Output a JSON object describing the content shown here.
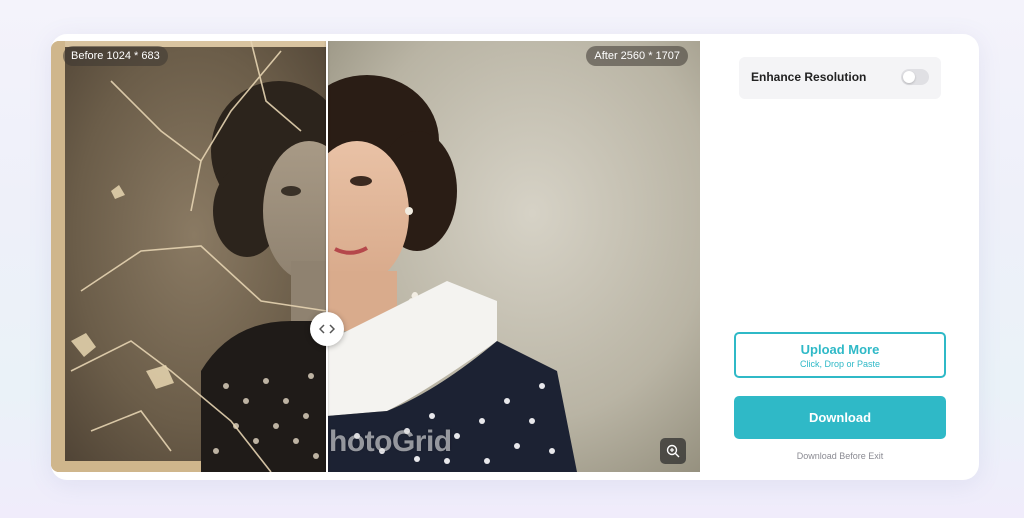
{
  "viewer": {
    "before_label": "Before 1024 * 683",
    "after_label": "After 2560 * 1707",
    "watermark": "hotoGrid",
    "slider_position": 0.425,
    "slider_icon": "chevron-left-right-icon",
    "zoom_icon": "zoom-in-icon"
  },
  "settings": {
    "enhance_label": "Enhance Resolution",
    "enhance_enabled": false
  },
  "actions": {
    "upload_title": "Upload More",
    "upload_subtitle": "Click, Drop or Paste",
    "download_label": "Download",
    "download_hint": "Download Before Exit"
  },
  "colors": {
    "accent": "#2fb9c7",
    "toggle_off": "#e0e0e4"
  }
}
